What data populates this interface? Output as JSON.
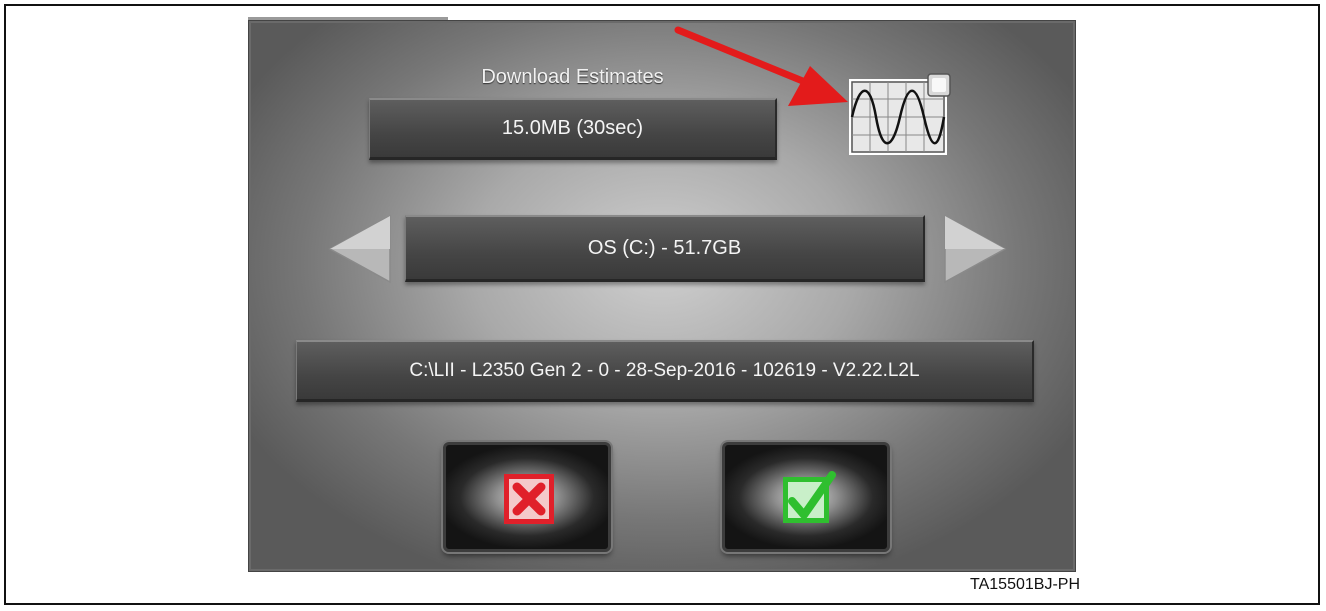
{
  "dialog": {
    "title": "Download Estimates",
    "estimate_value": "15.0MB (30sec)",
    "drive_label": "OS (C:) - 51.7GB",
    "file_path": "C:\\LII - L2350 Gen 2 - 0 - 28-Sep-2016 - 102619 - V2.22.L2L"
  },
  "icons": {
    "prev": "triangle-left-icon",
    "next": "triangle-right-icon",
    "waveform": "oscilloscope-waveform-icon",
    "cancel": "red-x-icon",
    "confirm": "green-checkmark-icon",
    "annotation": "red-arrow-pointer"
  },
  "colors": {
    "cancel": "#e0202a",
    "confirm": "#2fbf2f",
    "annotation_arrow": "#e31b1b"
  },
  "figure": {
    "caption": "TA15501BJ-PH"
  }
}
